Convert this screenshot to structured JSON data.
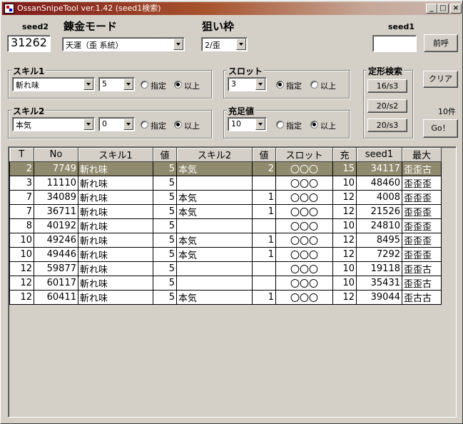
{
  "window": {
    "title": "OssanSnipeTool ver.1.42 (seed1検索)"
  },
  "top": {
    "seed2_label": "seed2",
    "seed2_value": "31262",
    "mode_label": "錬金モード",
    "mode_value": "天運（歪 系統）",
    "target_label": "狙い枠",
    "target_value": "2/歪",
    "seed1_label": "seed1",
    "seed1_value": "",
    "call_button": "前呼"
  },
  "skill1": {
    "legend": "スキル1",
    "skill": "斬れ味",
    "value": "5",
    "opt_exact": "指定",
    "opt_above": "以上",
    "selected": "above"
  },
  "skill2": {
    "legend": "スキル2",
    "skill": "本気",
    "value": "0",
    "opt_exact": "指定",
    "opt_above": "以上",
    "selected": "above"
  },
  "slot": {
    "legend": "スロット",
    "value": "3",
    "opt_exact": "指定",
    "opt_above": "以上",
    "selected": "exact"
  },
  "fill": {
    "legend": "充足値",
    "value": "10",
    "opt_exact": "指定",
    "opt_above": "以上",
    "selected": "above"
  },
  "fixed_search": {
    "legend": "定形検索",
    "buttons": [
      "16/s3",
      "20/s2",
      "20/s3"
    ]
  },
  "right": {
    "clear_button": "クリア",
    "count": "10件",
    "go_button": "Go！"
  },
  "table": {
    "headers": [
      "T",
      "No",
      "スキル1",
      "値",
      "スキル2",
      "値",
      "スロット",
      "充",
      "seed1",
      "最大"
    ],
    "rows": [
      [
        "2",
        "7749",
        "斬れ味",
        "5",
        "本気",
        "2",
        "〇〇〇",
        "15",
        "34117",
        "歪歪古"
      ],
      [
        "3",
        "11110",
        "斬れ味",
        "5",
        "",
        "",
        "〇〇〇",
        "10",
        "48460",
        "歪歪歪"
      ],
      [
        "7",
        "34089",
        "斬れ味",
        "5",
        "本気",
        "1",
        "〇〇〇",
        "12",
        "4008",
        "歪歪歪"
      ],
      [
        "7",
        "36711",
        "斬れ味",
        "5",
        "本気",
        "1",
        "〇〇〇",
        "12",
        "21526",
        "歪歪歪"
      ],
      [
        "8",
        "40192",
        "斬れ味",
        "5",
        "",
        "",
        "〇〇〇",
        "10",
        "24810",
        "歪歪歪"
      ],
      [
        "10",
        "49246",
        "斬れ味",
        "5",
        "本気",
        "1",
        "〇〇〇",
        "12",
        "8495",
        "歪歪歪"
      ],
      [
        "10",
        "49446",
        "斬れ味",
        "5",
        "本気",
        "1",
        "〇〇〇",
        "12",
        "7292",
        "歪歪歪"
      ],
      [
        "12",
        "59877",
        "斬れ味",
        "5",
        "",
        "",
        "〇〇〇",
        "10",
        "19118",
        "歪歪古"
      ],
      [
        "12",
        "60117",
        "斬れ味",
        "5",
        "",
        "",
        "〇〇〇",
        "10",
        "35431",
        "歪歪古"
      ],
      [
        "12",
        "60411",
        "斬れ味",
        "5",
        "本気",
        "1",
        "〇〇〇",
        "12",
        "39044",
        "歪古古"
      ]
    ],
    "selected_row": 0
  }
}
